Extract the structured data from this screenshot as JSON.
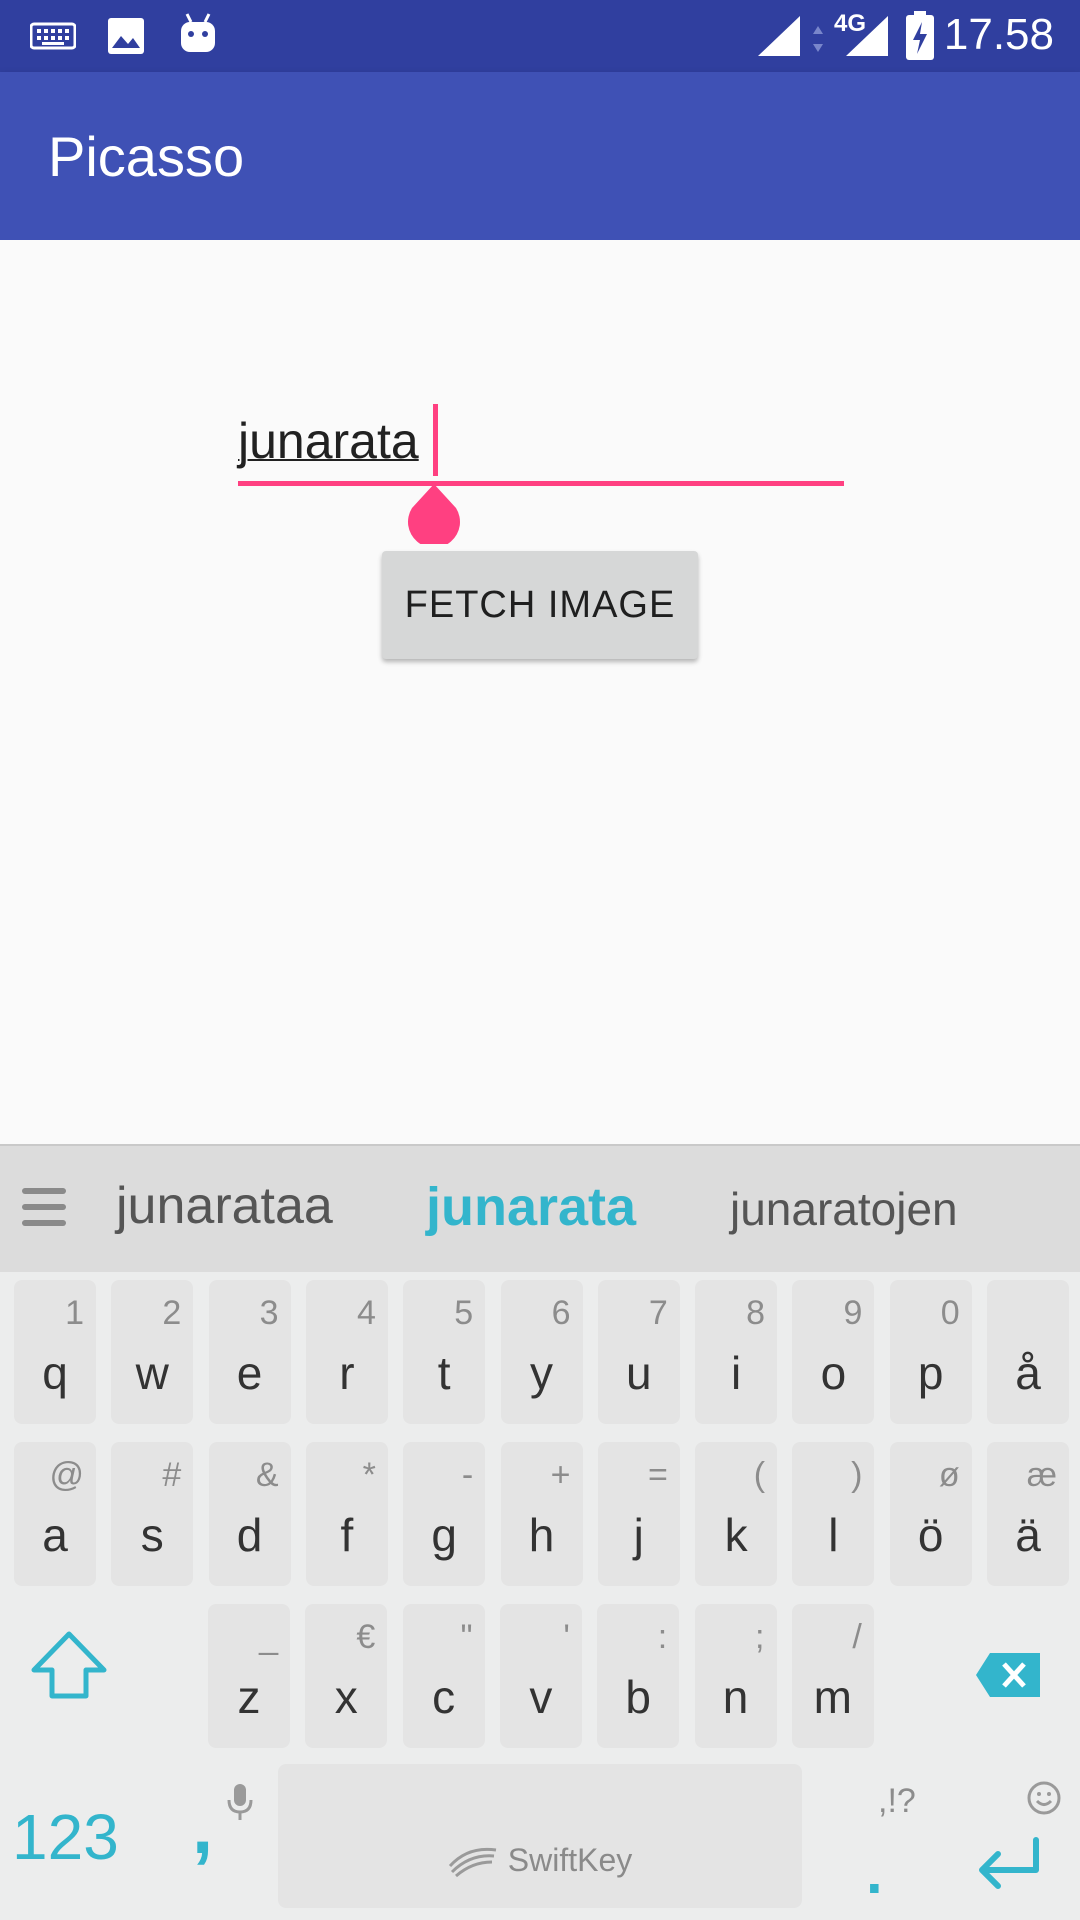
{
  "status_bar": {
    "time": "17.58",
    "network": "4G",
    "icons": [
      "keyboard-icon",
      "image-icon",
      "android-icon",
      "signal-icon",
      "data-arrows-icon",
      "signal-4g-icon",
      "battery-charging-icon"
    ]
  },
  "app_bar": {
    "title": "Picasso"
  },
  "main": {
    "search_input_value": "junarata",
    "fetch_button_label": "FETCH IMAGE"
  },
  "keyboard": {
    "suggestions": [
      "junarataa",
      "junarata",
      "junaratojen"
    ],
    "row1": [
      {
        "key": "q",
        "alt": "1"
      },
      {
        "key": "w",
        "alt": "2"
      },
      {
        "key": "e",
        "alt": "3"
      },
      {
        "key": "r",
        "alt": "4"
      },
      {
        "key": "t",
        "alt": "5"
      },
      {
        "key": "y",
        "alt": "6"
      },
      {
        "key": "u",
        "alt": "7"
      },
      {
        "key": "i",
        "alt": "8"
      },
      {
        "key": "o",
        "alt": "9"
      },
      {
        "key": "p",
        "alt": "0"
      },
      {
        "key": "å",
        "alt": ""
      }
    ],
    "row2": [
      {
        "key": "a",
        "alt": "@"
      },
      {
        "key": "s",
        "alt": "#"
      },
      {
        "key": "d",
        "alt": "&"
      },
      {
        "key": "f",
        "alt": "*"
      },
      {
        "key": "g",
        "alt": "-"
      },
      {
        "key": "h",
        "alt": "+"
      },
      {
        "key": "j",
        "alt": "="
      },
      {
        "key": "k",
        "alt": "("
      },
      {
        "key": "l",
        "alt": ")"
      },
      {
        "key": "ö",
        "alt": "ø"
      },
      {
        "key": "ä",
        "alt": "æ"
      }
    ],
    "row3": [
      {
        "key": "z",
        "alt": "_"
      },
      {
        "key": "x",
        "alt": "€"
      },
      {
        "key": "c",
        "alt": "\""
      },
      {
        "key": "v",
        "alt": "'"
      },
      {
        "key": "b",
        "alt": ":"
      },
      {
        "key": "n",
        "alt": ";"
      },
      {
        "key": "m",
        "alt": "/"
      }
    ],
    "num_key_label": "123",
    "comma_label": ",",
    "space_brand": "SwiftKey",
    "punct_alt": ",!?",
    "period_label": ".",
    "accent_color": "#33b5cc"
  }
}
